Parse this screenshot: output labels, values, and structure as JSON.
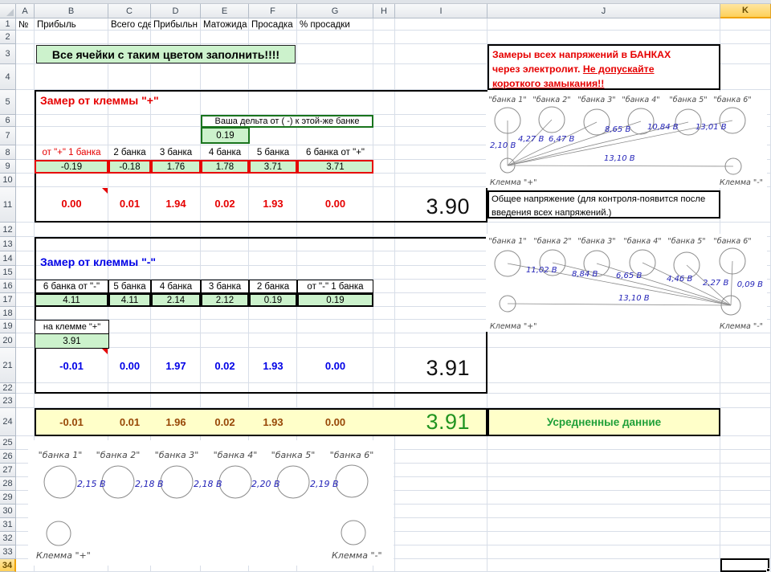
{
  "grid": {
    "columns": [
      "A",
      "B",
      "C",
      "D",
      "E",
      "F",
      "G",
      "H",
      "I",
      "J",
      "K"
    ],
    "rows": [
      "1",
      "2",
      "3",
      "4",
      "5",
      "6",
      "7",
      "8",
      "9",
      "10",
      "11",
      "12",
      "13",
      "14",
      "15",
      "16",
      "17",
      "18",
      "19",
      "20",
      "21",
      "22",
      "23",
      "24",
      "25",
      "26",
      "27",
      "28",
      "29",
      "30",
      "31",
      "32",
      "33",
      "34"
    ],
    "selected_column": "K",
    "selected_row": "34"
  },
  "row1": [
    "№",
    "Прибыль",
    "Всего сде",
    "Прибыльн",
    "Матожида",
    "Просадка",
    "% просадки"
  ],
  "instruction": "Все ячейки с таким цветом заполнить!!!!",
  "warning": {
    "line1": "Замеры всех напряжений в БАНКАХ",
    "line2a": "через электролит. ",
    "line2b": "Не допускайте",
    "line3": "короткого замыкания!!"
  },
  "plus_section": {
    "title": "Замер от клеммы \"+\"",
    "delta_label": "Ваша дельта от ( -) к этой-же банке",
    "delta_value": "0.19",
    "headers": [
      "от \"+\" 1 банка",
      "2 банка",
      "3 банка",
      "4 банка",
      "5 банка",
      "6 банка от \"+\""
    ],
    "measured": [
      "-0.19",
      "-0.18",
      "1.76",
      "1.78",
      "3.71",
      "3.71"
    ],
    "computed": [
      "0.00",
      "0.01",
      "1.94",
      "0.02",
      "1.93",
      "0.00"
    ],
    "total": "3.90"
  },
  "note": {
    "line1": "Общее напряжение (для контроля-появится после",
    "line2": "введения всех напряжений.)"
  },
  "minus_section": {
    "title": "Замер от клеммы \"-\"",
    "headers": [
      "6 банка от \"-\"",
      "5 банка",
      "4 банка",
      "3 банка",
      "2 банка",
      "от \"-\" 1 банка"
    ],
    "measured": [
      "4.11",
      "4.11",
      "2.14",
      "2.12",
      "0.19",
      "0.19"
    ],
    "terminal_label": "на клемме \"+\"",
    "terminal_value": "3.91",
    "computed": [
      "-0.01",
      "0.00",
      "1.97",
      "0.02",
      "1.93",
      "0.00"
    ],
    "total": "3.91"
  },
  "averaged": {
    "values": [
      "-0.01",
      "0.01",
      "1.96",
      "0.02",
      "1.93",
      "0.00"
    ],
    "total": "3.91",
    "label": "Усредненные данние"
  },
  "diagram_top": {
    "banks": [
      "\"банка 1\"",
      "\"банка 2\"",
      "\"банка 3\"",
      "\"банка 4\"",
      "\"банка 5\"",
      "\"банка 6\""
    ],
    "voltages": [
      "2,10 В",
      "4,27 В",
      "6,47 В",
      "8,65 В",
      "10,84 В",
      "13,01 В"
    ],
    "total": "13,10 В",
    "terminal_plus": "Клемма \"+\"",
    "terminal_minus": "Клемма \"-\""
  },
  "diagram_mid": {
    "banks": [
      "\"банка 1\"",
      "\"банка 2\"",
      "\"банка 3\"",
      "\"банка 4\"",
      "\"банка 5\"",
      "\"банка 6\""
    ],
    "voltages": [
      "11,02 В",
      "8,84 В",
      "6,65 В",
      "4,46 В",
      "2,27 В",
      "0,09 В"
    ],
    "total": "13,10 В",
    "terminal_plus": "Клемма \"+\"",
    "terminal_minus": "Клемма \"-\""
  },
  "diagram_bottom": {
    "banks": [
      "\"банка 1\"",
      "\"банка 2\"",
      "\"банка 3\"",
      "\"банка 4\"",
      "\"банка 5\"",
      "\"банка 6\""
    ],
    "voltages": [
      "2,15 В",
      "2,18 В",
      "2,18 В",
      "2,20 В",
      "2,19 В"
    ],
    "terminal_plus": "Клемма \"+\"",
    "terminal_minus": "Клемма \"-\""
  },
  "colors": {
    "fill_green": "#ccf2cc",
    "fill_yellow": "#ffffc9",
    "warning_red": "#e60000",
    "title_blue": "#0000e6",
    "delta_border_green": "#19741d",
    "averaged_text": "#974706",
    "total_green": "#219421",
    "label_green": "#1fa039",
    "diagram_blue": "#2424b8"
  }
}
